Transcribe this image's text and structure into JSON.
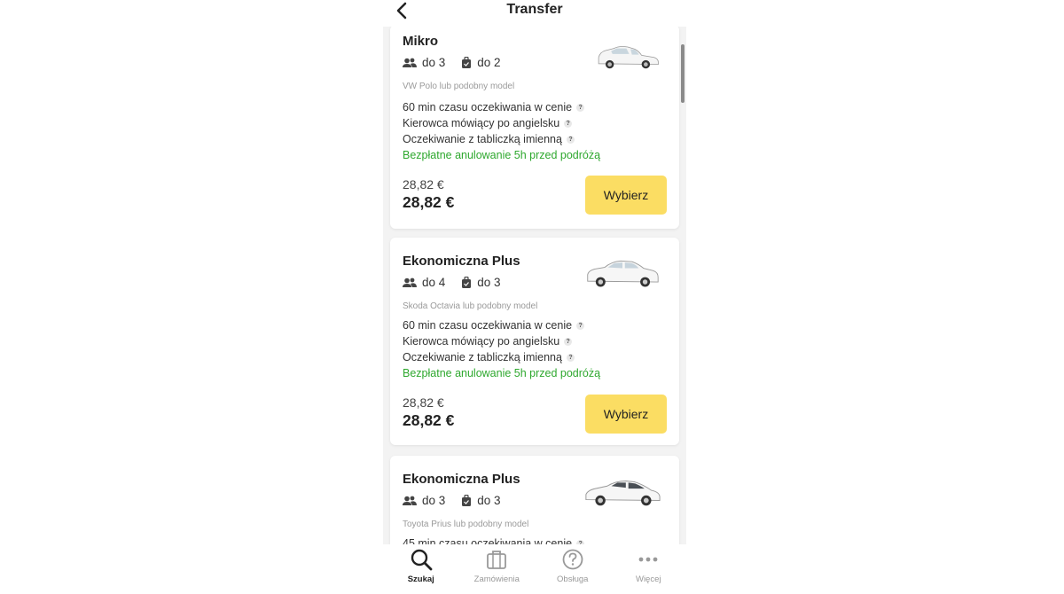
{
  "header": {
    "title": "Transfer",
    "back_icon": "chevron-left-icon"
  },
  "offers": [
    {
      "name": "Mikro",
      "passengers": "do 3",
      "luggage": "do 2",
      "model": "VW Polo lub podobny model",
      "features": [
        "60 min czasu oczekiwania w cenie",
        "Kierowca mówiący po angielsku",
        "Oczekiwanie z tabliczką imienną"
      ],
      "cancellation": "Bezpłatne anulowanie 5h przed podróżą",
      "price_old": "28,82 €",
      "price": "28,82 €",
      "button_label": "Wybierz"
    },
    {
      "name": "Ekonomiczna Plus",
      "passengers": "do 4",
      "luggage": "do 3",
      "model": "Skoda Octavia lub podobny model",
      "features": [
        "60 min czasu oczekiwania w cenie",
        "Kierowca mówiący po angielsku",
        "Oczekiwanie z tabliczką imienną"
      ],
      "cancellation": "Bezpłatne anulowanie 5h przed podróżą",
      "price_old": "28,82 €",
      "price": "28,82 €",
      "button_label": "Wybierz"
    },
    {
      "name": "Ekonomiczna Plus",
      "passengers": "do 3",
      "luggage": "do 3",
      "model": "Toyota Prius lub podobny model",
      "features": [
        "45 min czasu oczekiwania w cenie"
      ]
    }
  ],
  "help_glyph": "?",
  "tabs": [
    {
      "label": "Szukaj",
      "icon": "search-icon",
      "active": true
    },
    {
      "label": "Zamówienia",
      "icon": "briefcase-icon",
      "active": false
    },
    {
      "label": "Obsługa",
      "icon": "help-circle-icon",
      "active": false
    },
    {
      "label": "Więcej",
      "icon": "more-dots-icon",
      "active": false
    }
  ],
  "colors": {
    "button": "#fbdd63",
    "green": "#2ea82e",
    "active_tab": "#222222",
    "inactive_tab": "#999999"
  }
}
